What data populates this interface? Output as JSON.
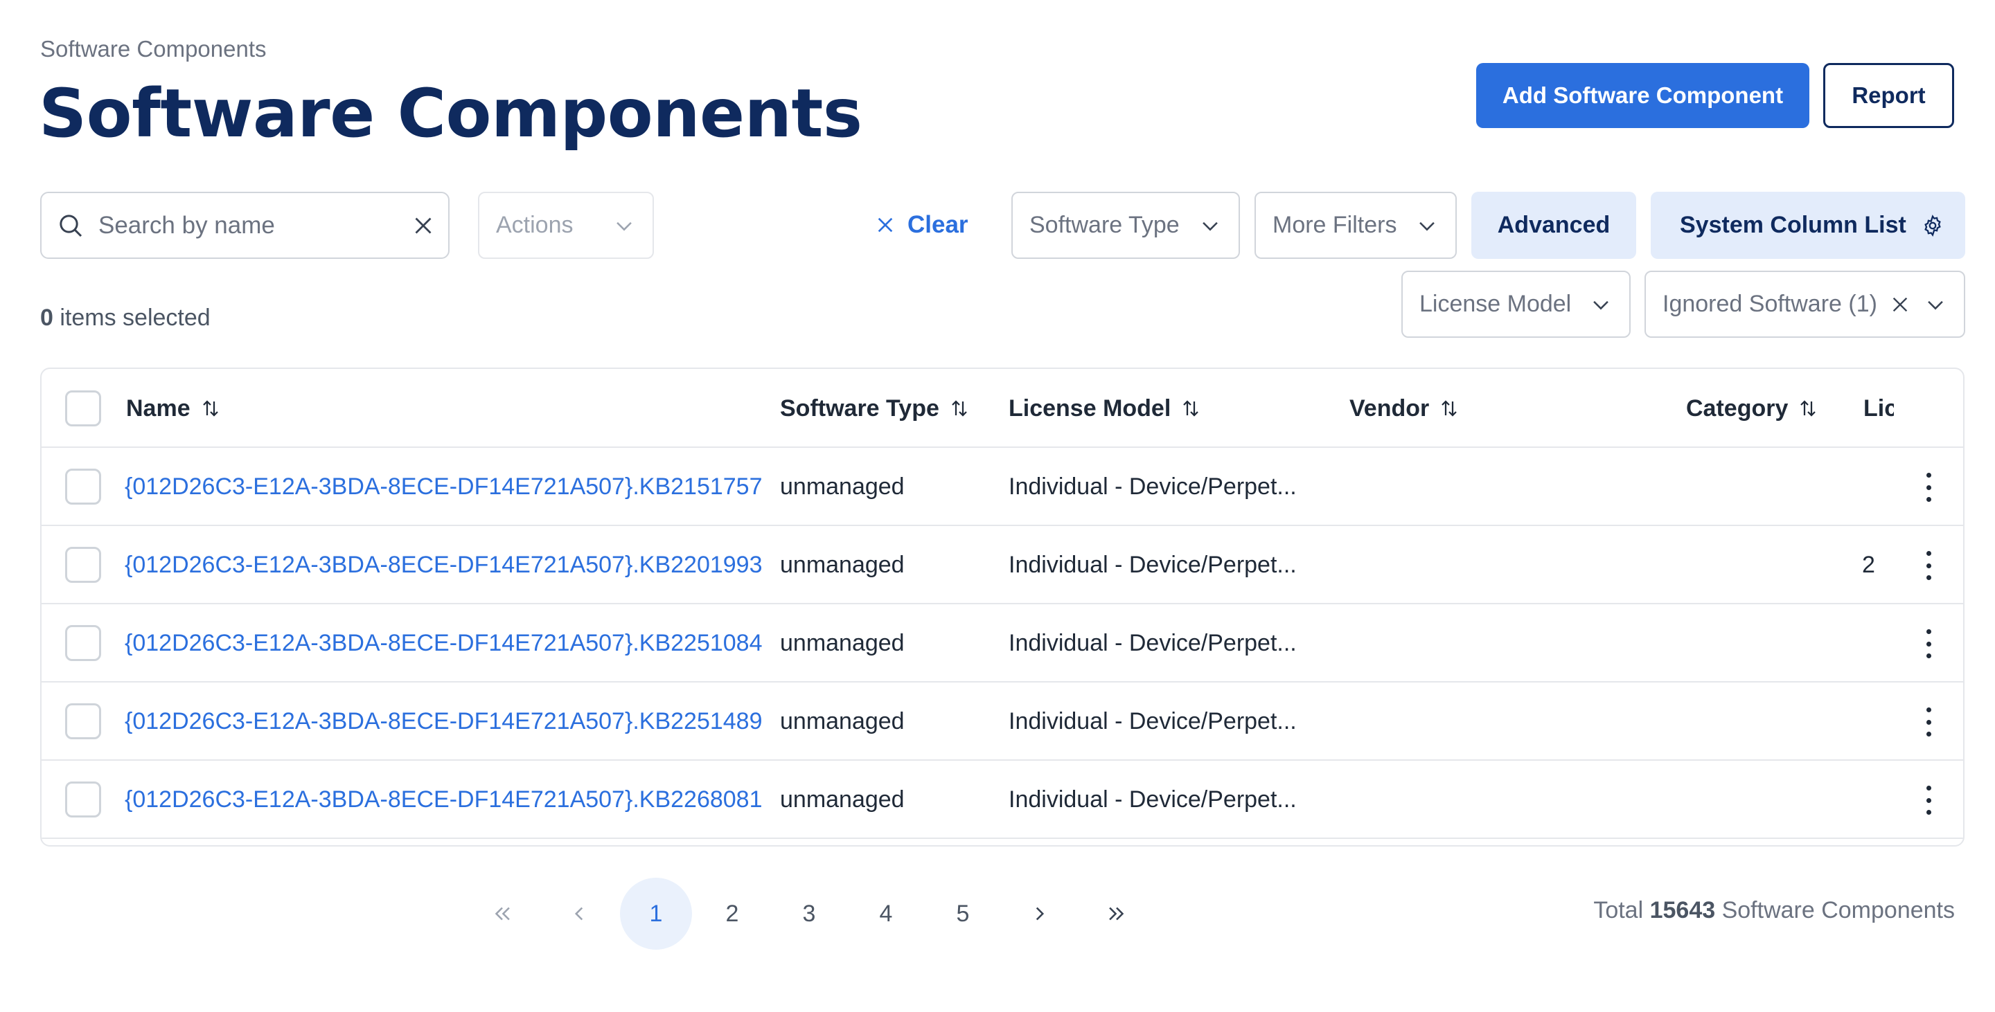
{
  "header": {
    "breadcrumb": "Software Components",
    "title": "Software Components",
    "add_button": "Add Software Component",
    "report_button": "Report"
  },
  "toolbar": {
    "search_placeholder": "Search by name",
    "actions_label": "Actions",
    "clear_label": "Clear",
    "software_type_label": "Software Type",
    "more_filters_label": "More Filters",
    "advanced_label": "Advanced",
    "column_list_label": "System Column List",
    "license_model_label": "License Model",
    "ignored_software_label": "Ignored Software (1)"
  },
  "selection": {
    "count": "0",
    "suffix": "items selected"
  },
  "table": {
    "columns": [
      "Name",
      "Software Type",
      "License Model",
      "Vendor",
      "Category",
      "Lic"
    ],
    "rows": [
      {
        "name": "{012D26C3-E12A-3BDA-8ECE-DF14E721A507}.KB2151757",
        "type": "unmanaged",
        "license": "Individual - Device/Perpet...",
        "vendor": "",
        "category": "",
        "lic": ""
      },
      {
        "name": "{012D26C3-E12A-3BDA-8ECE-DF14E721A507}.KB2201993",
        "type": "unmanaged",
        "license": "Individual - Device/Perpet...",
        "vendor": "",
        "category": "",
        "lic": "2"
      },
      {
        "name": "{012D26C3-E12A-3BDA-8ECE-DF14E721A507}.KB2251084",
        "type": "unmanaged",
        "license": "Individual - Device/Perpet...",
        "vendor": "",
        "category": "",
        "lic": ""
      },
      {
        "name": "{012D26C3-E12A-3BDA-8ECE-DF14E721A507}.KB2251489",
        "type": "unmanaged",
        "license": "Individual - Device/Perpet...",
        "vendor": "",
        "category": "",
        "lic": ""
      },
      {
        "name": "{012D26C3-E12A-3BDA-8ECE-DF14E721A507}.KB2268081",
        "type": "unmanaged",
        "license": "Individual - Device/Perpet...",
        "vendor": "",
        "category": "",
        "lic": ""
      }
    ]
  },
  "pagination": {
    "pages": [
      "1",
      "2",
      "3",
      "4",
      "5"
    ],
    "current": "1",
    "total_prefix": "Total",
    "total_count": "15643",
    "total_suffix": "Software Components"
  },
  "colors": {
    "primary": "#2b6fde",
    "title": "#0f2a5e",
    "soft_button_bg": "#e3ecfb"
  }
}
